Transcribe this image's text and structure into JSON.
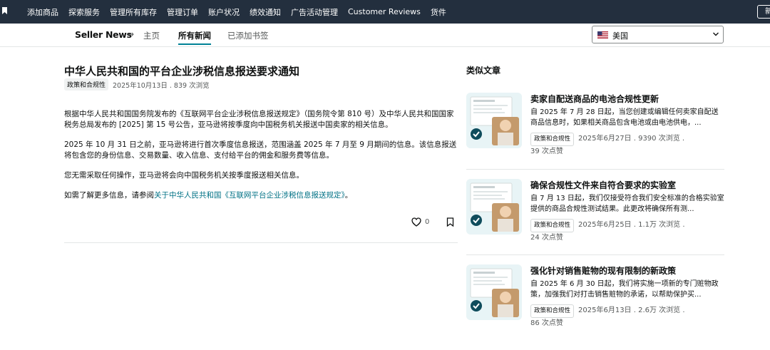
{
  "topnav": {
    "items": [
      "添加商品",
      "探索服务",
      "管理所有库存",
      "管理订单",
      "账户状况",
      "绩效通知",
      "广告活动管理",
      "Customer Reviews",
      "货件"
    ],
    "right_button": "新"
  },
  "subnav": {
    "brand": "Seller News",
    "tabs": [
      "主页",
      "所有新闻",
      "已添加书签"
    ],
    "active_tab": "所有新闻",
    "country": "美国"
  },
  "article": {
    "title": "中华人民共和国的平台企业涉税信息报送要求通知",
    "tag": "政策和合规性",
    "meta": "2025年10月13日 . 839 次浏览",
    "paragraphs": [
      "根据中华人民共和国国务院发布的《互联网平台企业涉税信息报送规定》（国务院令第 810 号）及中华人民共和国国家税务总局发布的 [2025] 第 15 号公告，亚马逊将按季度向中国税务机关报送中国卖家的相关信息。",
      "2025 年 10 月 31 日之前，亚马逊将进行首次季度信息报送，范围涵盖 2025 年 7 月至 9 月期间的信息。该信息报送将包含您的身份信息、交易数量、收入信息、支付给平台的佣金和服务费等信息。",
      "您无需采取任何操作，亚马逊将会向中国税务机关按季度报送相关信息。"
    ],
    "more_prefix": "如需了解更多信息，请参阅",
    "more_link": "关于中华人民共和国《互联网平台企业涉税信息报送规定》",
    "more_suffix": "。",
    "like_count": "0"
  },
  "sidebar": {
    "title": "类似文章",
    "cards": [
      {
        "title": "卖家自配送商品的电池合规性更新",
        "desc": "自 2025 年 7 月 28 日起，当您创建或编辑任何卖家自配送商品信息时，如果相关商品包含电池或由电池供电，...",
        "tag": "政策和合规性",
        "meta": "2025年6月27日 . 9390 次浏览 .",
        "likes": "39 次点赞"
      },
      {
        "title": "确保合规性文件来自符合要求的实验室",
        "desc": "自 7 月 13 日起，我们仅接受符合我们安全标准的合格实验室提供的商品合规性测试结果。此更改将确保所有测...",
        "tag": "政策和合规性",
        "meta": "2025年6月25日 . 1.1万 次浏览 .",
        "likes": "24 次点赞"
      },
      {
        "title": "强化针对销售赃物的现有限制的新政策",
        "desc": "自 2025 年 6 月 30 日起，我们将实施一项新的专门赃物政策，加强我们对打击销售赃物的承诺，以帮助保护买...",
        "tag": "政策和合规性",
        "meta": "2025年6月13日 . 2.6万 次浏览 .",
        "likes": "86 次点赞"
      }
    ]
  },
  "colors": {
    "topnav_bg": "#232f3e",
    "link": "#007185",
    "active_underline": "#008296"
  }
}
